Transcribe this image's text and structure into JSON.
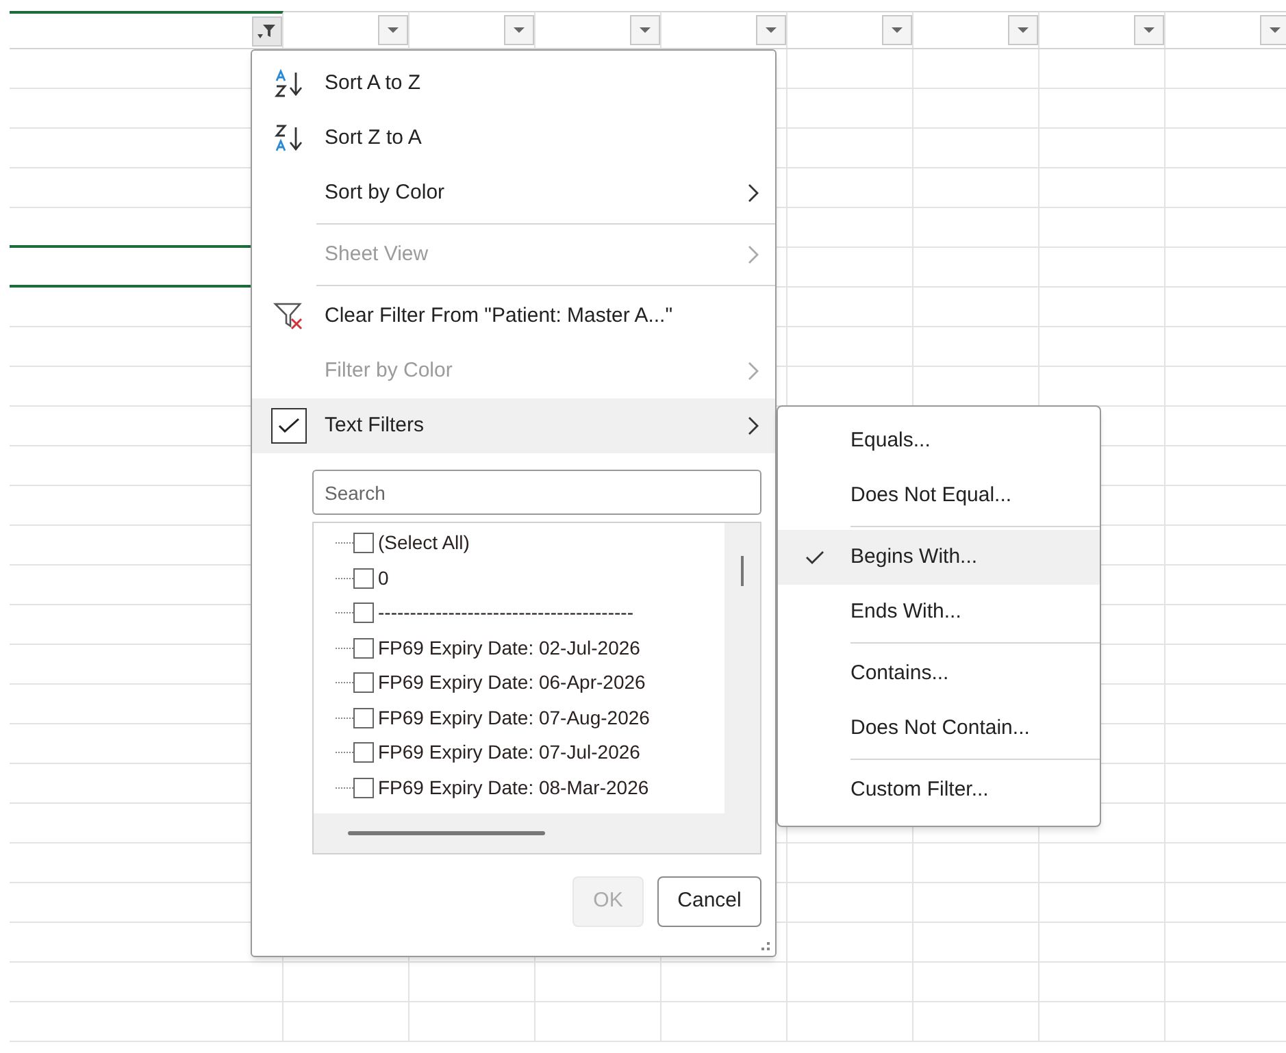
{
  "column_headers": [
    {
      "filtered": true
    },
    {
      "filtered": false
    },
    {
      "filtered": false
    },
    {
      "filtered": false
    },
    {
      "filtered": false
    },
    {
      "filtered": false
    },
    {
      "filtered": false
    },
    {
      "filtered": false
    },
    {
      "filtered": false
    }
  ],
  "menu": {
    "items": [
      {
        "kind": "sort_asc",
        "label": "Sort A to Z",
        "disabled": false,
        "submenu": false,
        "highlighted": false
      },
      {
        "kind": "sort_desc",
        "label": "Sort Z to A",
        "disabled": false,
        "submenu": false,
        "highlighted": false
      },
      {
        "kind": "plain",
        "label": "Sort by Color",
        "disabled": false,
        "submenu": true,
        "highlighted": false
      },
      {
        "kind": "separator"
      },
      {
        "kind": "plain",
        "label": "Sheet View",
        "disabled": true,
        "submenu": true,
        "highlighted": false
      },
      {
        "kind": "separator"
      },
      {
        "kind": "clear_filter",
        "label": "Clear Filter From \"Patient: Master A...\"",
        "disabled": false,
        "submenu": false,
        "highlighted": false
      },
      {
        "kind": "plain",
        "label": "Filter by Color",
        "disabled": true,
        "submenu": true,
        "highlighted": false
      },
      {
        "kind": "checkbox",
        "label": "Text Filters",
        "checked": true,
        "disabled": false,
        "submenu": true,
        "highlighted": true
      }
    ],
    "search": {
      "placeholder": "Search"
    },
    "values": [
      {
        "label": "(Select All)",
        "checked": false
      },
      {
        "label": "0",
        "checked": false
      },
      {
        "label": "----------------------------------------",
        "checked": false
      },
      {
        "label": "FP69 Expiry Date: 02-Jul-2026",
        "checked": false
      },
      {
        "label": "FP69 Expiry Date: 06-Apr-2026",
        "checked": false
      },
      {
        "label": "FP69 Expiry Date: 07-Aug-2026",
        "checked": false
      },
      {
        "label": "FP69 Expiry Date: 07-Jul-2026",
        "checked": false
      },
      {
        "label": "FP69 Expiry Date: 08-Mar-2026",
        "checked": false
      }
    ],
    "buttons": [
      {
        "label": "OK",
        "disabled": true
      },
      {
        "label": "Cancel",
        "disabled": false
      }
    ]
  },
  "submenu": {
    "items": [
      {
        "kind": "item",
        "label": "Equals...",
        "selected": false
      },
      {
        "kind": "item",
        "label": "Does Not Equal...",
        "selected": false
      },
      {
        "kind": "separator"
      },
      {
        "kind": "item",
        "label": "Begins With...",
        "selected": true
      },
      {
        "kind": "item",
        "label": "Ends With...",
        "selected": false
      },
      {
        "kind": "separator"
      },
      {
        "kind": "item",
        "label": "Contains...",
        "selected": false
      },
      {
        "kind": "item",
        "label": "Does Not Contain...",
        "selected": false
      },
      {
        "kind": "separator"
      },
      {
        "kind": "item",
        "label": "Custom Filter...",
        "selected": false
      }
    ]
  }
}
